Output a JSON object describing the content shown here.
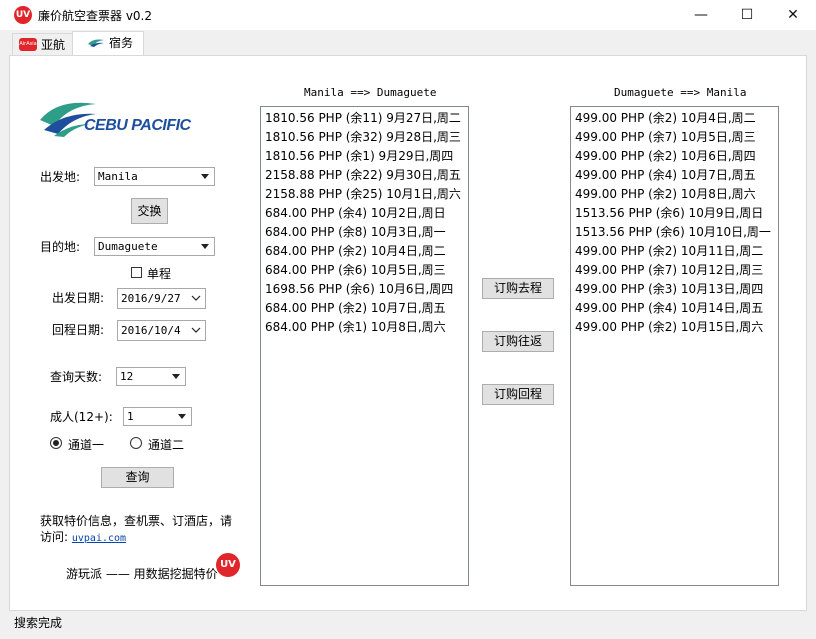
{
  "window": {
    "title": "廉价航空查票器 v0.2",
    "icon_text": "UV",
    "minimize": "—",
    "maximize": "☐",
    "close": "✕"
  },
  "tabs": [
    {
      "label": "亚航",
      "icon_text": "AirAsia"
    },
    {
      "label": "宿务"
    }
  ],
  "logo": {
    "text": "CEBU PACIFIC",
    "color": "#1e4f9c",
    "accent": "#2e9e89"
  },
  "form": {
    "origin_label": "出发地:",
    "origin_value": "Manila",
    "swap_label": "交换",
    "dest_label": "目的地:",
    "dest_value": "Dumaguete",
    "oneway_label": "单程",
    "depart_label": "出发日期:",
    "depart_value": "2016/9/27",
    "return_label": "回程日期:",
    "return_value": "2016/10/4",
    "days_label": "查询天数:",
    "days_value": "12",
    "adults_label": "成人(12+):",
    "adults_value": "1",
    "channel1_label": "通道一",
    "channel2_label": "通道二",
    "search_label": "查询"
  },
  "info": {
    "text": "获取特价信息，查机票、订酒店，请访问:",
    "link": "uvpai.com",
    "slogan": "游玩派 —— 用数据挖掘特价",
    "badge": "UV"
  },
  "outbound": {
    "header": "Manila ==> Dumaguete",
    "rows": [
      "1810.56 PHP (余11) 9月27日,周二",
      "1810.56 PHP (余32) 9月28日,周三",
      "1810.56 PHP (余1) 9月29日,周四",
      "2158.88 PHP (余22) 9月30日,周五",
      "2158.88 PHP (余25) 10月1日,周六",
      "684.00 PHP (余4) 10月2日,周日",
      "684.00 PHP (余8) 10月3日,周一",
      "684.00 PHP (余2) 10月4日,周二",
      "684.00 PHP (余6) 10月5日,周三",
      "1698.56 PHP (余6) 10月6日,周四",
      "684.00 PHP (余2) 10月7日,周五",
      "684.00 PHP (余1) 10月8日,周六"
    ]
  },
  "inbound": {
    "header": "Dumaguete ==> Manila",
    "rows": [
      "499.00 PHP (余2) 10月4日,周二",
      "499.00 PHP (余7) 10月5日,周三",
      "499.00 PHP (余2) 10月6日,周四",
      "499.00 PHP (余4) 10月7日,周五",
      "499.00 PHP (余2) 10月8日,周六",
      "1513.56 PHP (余6) 10月9日,周日",
      "1513.56 PHP (余6) 10月10日,周一",
      "499.00 PHP (余2) 10月11日,周二",
      "499.00 PHP (余7) 10月12日,周三",
      "499.00 PHP (余3) 10月13日,周四",
      "499.00 PHP (余4) 10月14日,周五",
      "499.00 PHP (余2) 10月15日,周六"
    ]
  },
  "actions": {
    "book_out": "订购去程",
    "book_round": "订购往返",
    "book_return": "订购回程"
  },
  "status": "搜索完成"
}
